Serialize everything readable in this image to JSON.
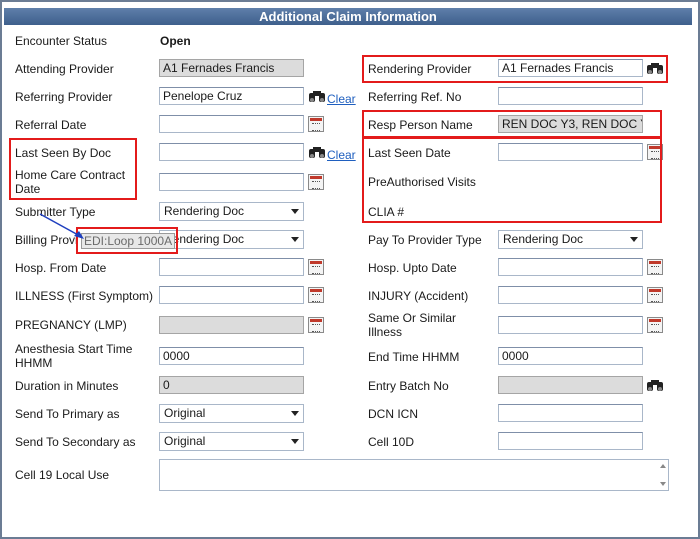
{
  "title": "Additional Claim Information",
  "fields": {
    "encounter_status": {
      "label": "Encounter Status",
      "value": "Open"
    },
    "attending_provider": {
      "label": "Attending Provider",
      "value": "A1 Fernades Francis"
    },
    "rendering_provider": {
      "label": "Rendering Provider",
      "value": "A1 Fernades Francis"
    },
    "referring_provider": {
      "label": "Referring Provider",
      "value": "Penelope Cruz",
      "clear": "Clear"
    },
    "referring_ref_no": {
      "label": "Referring Ref. No",
      "value": ""
    },
    "referral_date": {
      "label": "Referral Date",
      "value": ""
    },
    "resp_person_name": {
      "label": "Resp Person Name",
      "value": "REN DOC Y3, REN DOC Y"
    },
    "last_seen_by_doc": {
      "label": "Last Seen By Doc",
      "value": "",
      "clear": "Clear"
    },
    "last_seen_date": {
      "label": "Last Seen Date",
      "value": ""
    },
    "home_care_contract_date": {
      "label1": "Home Care Contract",
      "label2": "Date",
      "value": ""
    },
    "preauthorised_visits": {
      "label": "PreAuthorised Visits"
    },
    "submitter_type": {
      "label": "Submitter Type",
      "value": "Rendering Doc"
    },
    "clia": {
      "label": "CLIA #"
    },
    "billing_provider": {
      "label": "Billing Provi",
      "value": "Rendering Doc"
    },
    "tooltip": "EDI:Loop 1000A",
    "pay_to_provider_type": {
      "label": "Pay To Provider Type",
      "value": "Rendering Doc"
    },
    "hosp_from_date": {
      "label": "Hosp. From Date",
      "value": ""
    },
    "hosp_upto_date": {
      "label": "Hosp. Upto Date",
      "value": ""
    },
    "illness": {
      "label": "ILLNESS (First Symptom)",
      "value": ""
    },
    "injury": {
      "label": "INJURY (Accident)",
      "value": ""
    },
    "pregnancy": {
      "label": "PREGNANCY (LMP)",
      "value": ""
    },
    "same_similar_illness": {
      "label1": "Same Or Similar",
      "label2": "Illness",
      "value": ""
    },
    "anesthesia_start": {
      "label1": "Anesthesia Start Time",
      "label2": "HHMM",
      "value": "0000"
    },
    "end_time": {
      "label": "End Time HHMM",
      "value": "0000"
    },
    "duration": {
      "label": "Duration in Minutes",
      "value": "0"
    },
    "entry_batch_no": {
      "label": "Entry Batch No",
      "value": ""
    },
    "send_to_primary": {
      "label": "Send To Primary as",
      "value": "Original"
    },
    "dcn_icn": {
      "label": "DCN ICN",
      "value": ""
    },
    "send_to_secondary": {
      "label": "Send To Secondary as",
      "value": "Original"
    },
    "cell_10d": {
      "label": "Cell 10D",
      "value": ""
    },
    "cell_19": {
      "label": "Cell 19 Local Use",
      "value": ""
    }
  },
  "icons": {
    "lookup": "binoculars-icon",
    "calendar": "calendar-icon"
  }
}
